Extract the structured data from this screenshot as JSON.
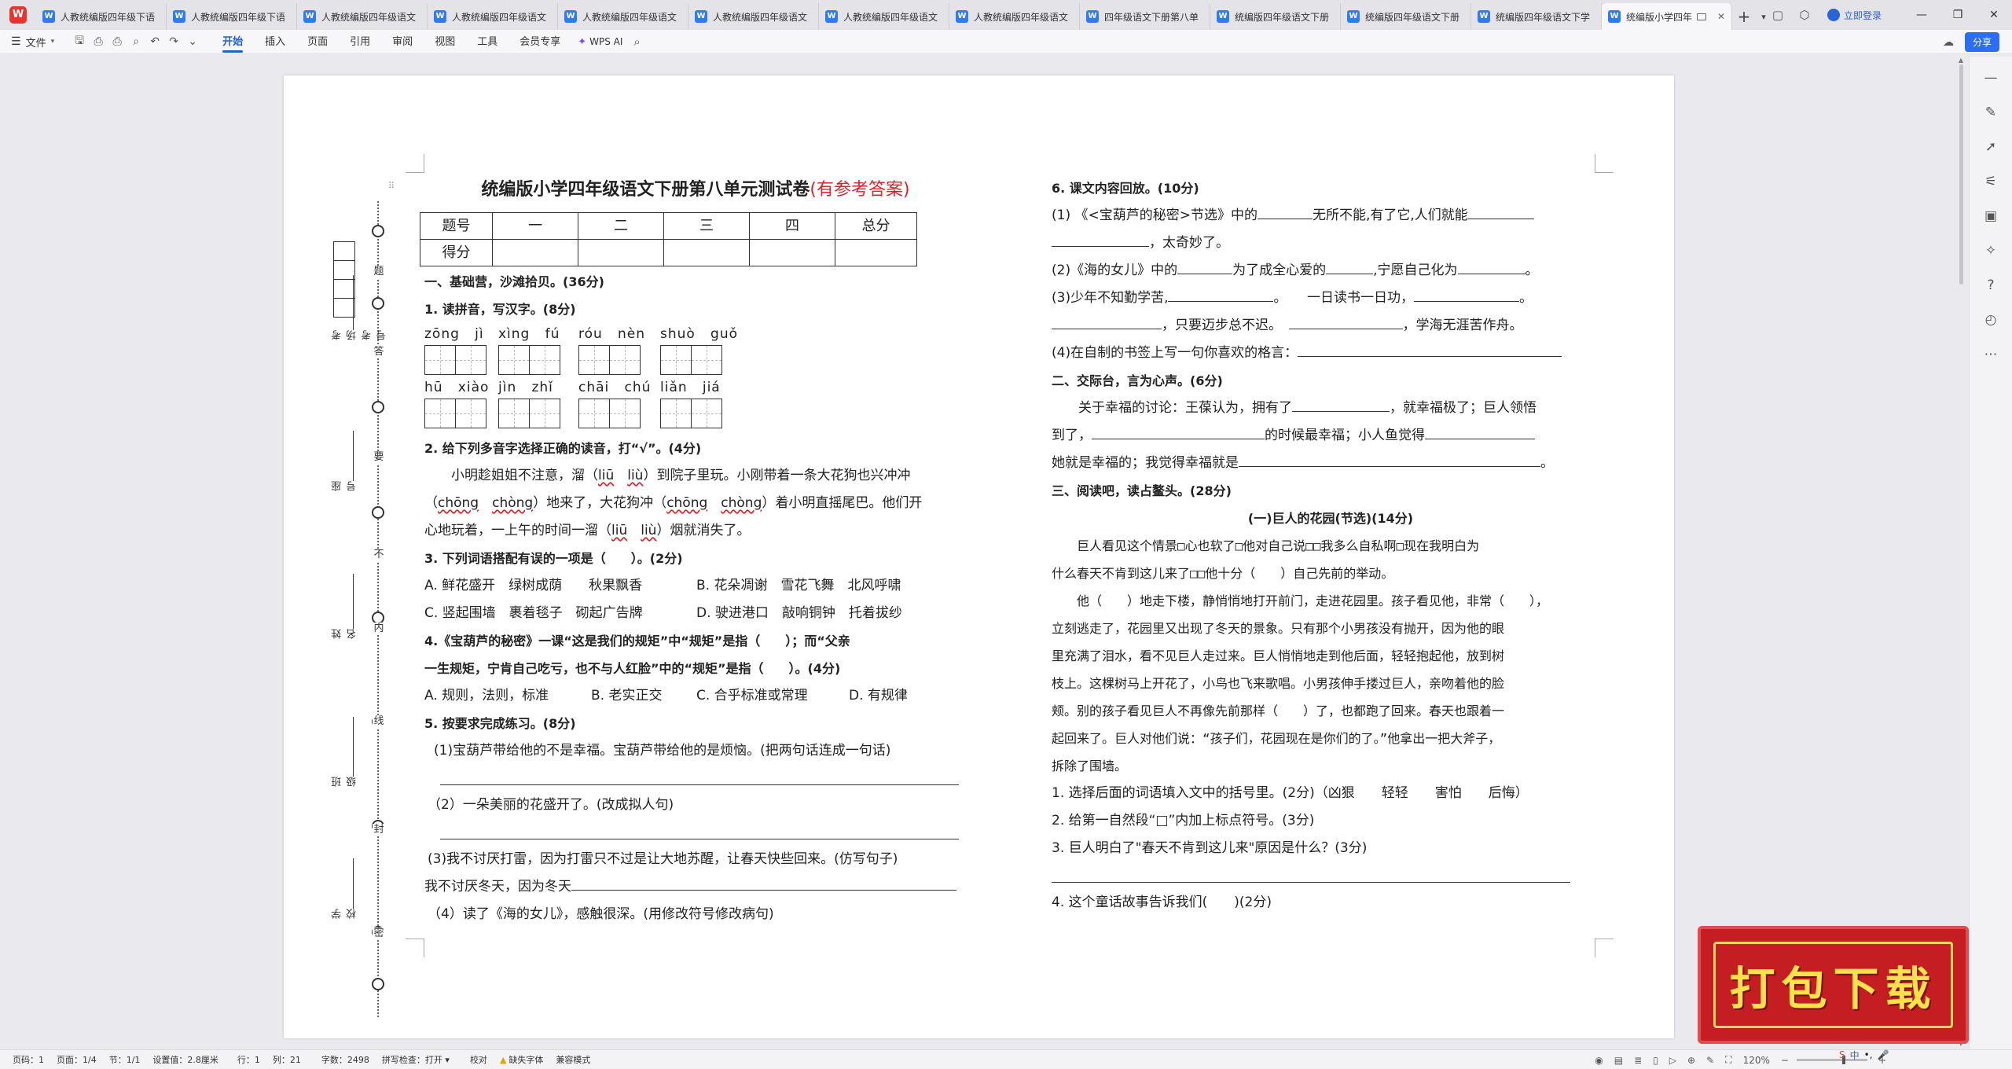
{
  "tabs": [
    {
      "label": "人教统编版四年级下语"
    },
    {
      "label": "人教统编版四年级下语"
    },
    {
      "label": "人教统编版四年级语文"
    },
    {
      "label": "人教统编版四年级语文"
    },
    {
      "label": "人教统编版四年级语文"
    },
    {
      "label": "人教统编版四年级语文"
    },
    {
      "label": "人教统编版四年级语文"
    },
    {
      "label": "人教统编版四年级语文"
    },
    {
      "label": "四年级语文下册第八单"
    },
    {
      "label": "统编版四年级语文下册"
    },
    {
      "label": "统编版四年级语文下册"
    },
    {
      "label": "统编版四年级语文下学"
    },
    {
      "label": "统编版小学四年"
    }
  ],
  "app": {
    "logo": "W",
    "login": "立即登录"
  },
  "menubar": {
    "file": "文件",
    "items": [
      "开始",
      "插入",
      "页面",
      "引用",
      "审阅",
      "视图",
      "工具",
      "会员专享"
    ],
    "active": "开始",
    "wps_ai": "WPS AI",
    "share": "分享"
  },
  "binding": {
    "chars": [
      "题",
      "答",
      "要",
      "不",
      "内",
      "线",
      "封",
      "密"
    ],
    "fields": [
      "考场考号",
      "座号",
      "姓名",
      "班级",
      "学校"
    ]
  },
  "doc": {
    "title_main": "统编版小学四年级语文下册第八单元测试卷",
    "title_note": "(有参考答案)",
    "score_table": {
      "row1": [
        "题号",
        "一",
        "二",
        "三",
        "四",
        "总分"
      ],
      "row2_label": "得分"
    },
    "left": {
      "sec1": "一、基础营，沙滩拾贝。(36分)",
      "q1": "1. 读拼音，写汉字。(8分)",
      "pinyin": [
        [
          "zōng",
          "jì"
        ],
        [
          "xìng",
          "fú"
        ],
        [
          "róu",
          "nèn"
        ],
        [
          "shuò",
          "guǒ"
        ],
        [
          "hū",
          "xiào"
        ],
        [
          "jìn",
          "zhǐ"
        ],
        [
          "chāi",
          "chú"
        ],
        [
          "liǎn",
          "jiá"
        ]
      ],
      "q2": "2. 给下列多音字选择正确的读音，打“√”。(4分)",
      "q2_p1a": "小明趁姐姐不注意，溜（",
      "q2_p1b": "liū",
      "q2_p1c": "liù",
      "q2_p1d": "）到院子里玩。小刚带着一条大花狗也兴冲冲",
      "q2_p2a": "（",
      "q2_p2b": "chōng",
      "q2_p2c": "chòng",
      "q2_p2d": "）地来了，大花狗冲（",
      "q2_p2e": "chōng",
      "q2_p2f": "chòng",
      "q2_p2g": "）着小明直摇尾巴。他们开",
      "q2_p3a": "心地玩着，一上午的时间一溜（",
      "q2_p3b": "liū",
      "q2_p3c": "liù",
      "q2_p3d": "）烟就消失了。",
      "q3": "3. 下列词语搭配有误的一项是（　　）。(2分)",
      "q3_opts": [
        [
          "A. 鲜花盛开　绿树成荫　　秋果飘香",
          "B. 花朵凋谢　雪花飞舞　北风呼啸"
        ],
        [
          "C. 竖起围墙　裹着毯子　砌起广告牌",
          "D. 驶进港口　敲响铜钟　托着拔纱"
        ]
      ],
      "q4a": "4.《宝葫芦的秘密》一课“这是我们的规矩”中“规矩”是指（　　）；而“父亲",
      "q4b": "一生规矩，宁肯自己吃亏，也不与人红脸”中的“规矩”是指（　　）。(4分)",
      "q4_opts": [
        "A. 规则，法则，标准",
        "B. 老实正交",
        "C. 合乎标准或常理",
        "D. 有规律"
      ],
      "q5": "5. 按要求完成练习。(8分)",
      "q5_1": "(1)宝葫芦带给他的不是幸福。宝葫芦带给他的是烦恼。(把两句话连成一句话)",
      "q5_2": "（2）一朵美丽的花盛开了。(改成拟人句)",
      "q5_3": "(3)我不讨厌打雷，因为打雷只不过是让大地苏醒，让春天快些回来。(仿写句子)",
      "q5_3b": "我不讨厌冬天，因为冬天",
      "q5_4": "（4）读了《海的女儿》，感触很深。(用修改符号修改病句)"
    },
    "right": {
      "q6": "6. 课文内容回放。(10分)",
      "q6_1a": "(1) 《<宝葫芦的秘密>节选》中的",
      "q6_1b": "无所不能,有了它,人们就能",
      "q6_1c": "，太奇妙了。",
      "q6_2a": "(2)《海的女儿》中的",
      "q6_2b": "为了成全心爱的",
      "q6_2c": ",宁愿自己化为",
      "q6_2d": "。",
      "q6_3a": "(3)少年不知勤学苦,",
      "q6_3b": "。　　一日读书一日功，",
      "q6_3c": "。",
      "q6_3d": "，只要迈步总不迟。　",
      "q6_3e": "，学海无涯苦作舟。",
      "q6_4": "(4)在自制的书签上写一句你喜欢的格言：",
      "sec2": "二、交际台，言为心声。(6分)",
      "s2a": "关于幸福的讨论：王葆认为，拥有了",
      "s2b": "，就幸福极了；巨人领悟",
      "s2c": "到了，",
      "s2d": "的时候最幸福；小人鱼觉得",
      "s2e": "她就是幸福的；我觉得幸福就是",
      "s2f": "。",
      "sec3": "三、阅读吧，读占鳌头。(28分)",
      "passage_title": "(一)巨人的花园(节选)(14分)",
      "passage": [
        "巨人看见这个情景□心也软了□他对自己说□□我多么自私啊□现在我明白为",
        "什么春天不肯到这儿来了□□他十分（　　）自己先前的举动。",
        "他（　　）地走下楼，静悄悄地打开前门，走进花园里。孩子看见他，非常（　　），",
        "立刻逃走了，花园里又出现了冬天的景象。只有那个小男孩没有抛开，因为他的眼",
        "里充满了泪水，看不见巨人走过来。巨人悄悄地走到他后面，轻轻抱起他，放到树",
        "枝上。这棵树马上开花了，小鸟也飞来歌唱。小男孩伸手搂过巨人，亲吻着他的脸",
        "颊。别的孩子看见巨人不再像先前那样（　　）了，也都跑了回来。春天也跟着一",
        "起回来了。巨人对他们说：“孩子们，花园现在是你们的了。”他拿出一把大斧子，",
        "拆除了围墙。"
      ],
      "r1": "1. 选择后面的词语填入文中的括号里。(2分)（凶狠　　轻轻　　害怕　　后悔）",
      "r2": "2. 给第一自然段“□”内加上标点符号。(3分)",
      "r3": "3. 巨人明白了\"春天不肯到这儿来\"原因是什么？(3分)",
      "r4": "4. 这个童话故事告诉我们(　　)(2分)"
    }
  },
  "statusbar": {
    "page": "页码：1",
    "pages": "页面：1/4",
    "section": "节：1/1",
    "setting": "设置值：2.8厘米",
    "line": "行：1",
    "col": "列：21",
    "words": "字数：2498",
    "spell": "拼写检查：打开",
    "proof": "校对",
    "missing_font": "缺失字体",
    "compat": "兼容模式",
    "zoom": "120%"
  },
  "banner": {
    "text": "打包下载"
  },
  "ime": {
    "text": "中"
  }
}
